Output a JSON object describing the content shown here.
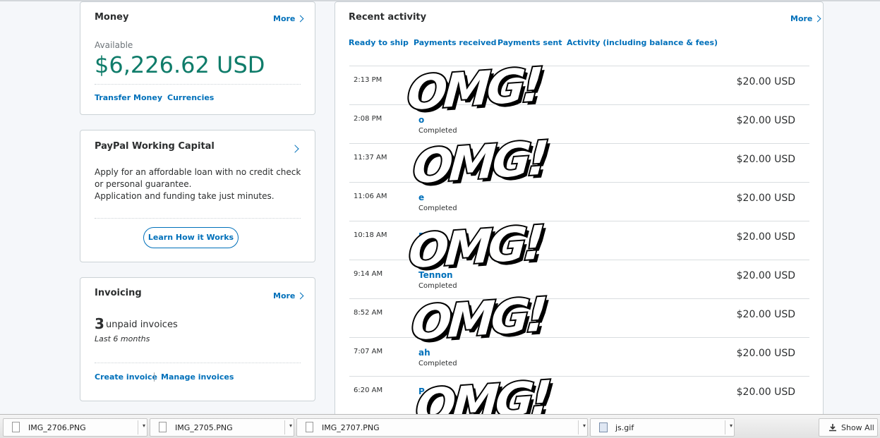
{
  "money": {
    "title": "Money",
    "more": "More",
    "available_label": "Available",
    "amount": "$6,226.62 USD",
    "transfer": "Transfer Money",
    "dot": "·",
    "currencies": "Currencies"
  },
  "working_capital": {
    "title": "PayPal Working Capital",
    "line1": "Apply for an affordable loan with no credit check",
    "line2": "or personal guarantee.",
    "line3": "Application and funding take just minutes.",
    "button": "Learn How it Works"
  },
  "invoicing": {
    "title": "Invoicing",
    "more": "More",
    "count": "3",
    "count_label": "unpaid invoices",
    "period": "Last 6 months",
    "create": "Create invoice",
    "manage": "Manage invoices"
  },
  "activity": {
    "title": "Recent activity",
    "more": "More",
    "tabs": [
      "Ready to ship",
      "Payments received",
      "Payments sent",
      "Activity (including balance & fees)"
    ],
    "rows": [
      {
        "time": "2:13 PM",
        "name": "",
        "status": "",
        "amount": "$20.00 USD"
      },
      {
        "time": "2:08 PM",
        "name": "o",
        "status": "Completed",
        "amount": "$20.00 USD"
      },
      {
        "time": "11:37 AM",
        "name": "P",
        "status": "",
        "amount": "$20.00 USD"
      },
      {
        "time": "11:06 AM",
        "name": "e",
        "status": "Completed",
        "amount": "$20.00 USD"
      },
      {
        "time": "10:18 AM",
        "name": "P",
        "status": "",
        "amount": "$20.00 USD"
      },
      {
        "time": "9:14 AM",
        "name": "Tennon",
        "status": "Completed",
        "amount": "$20.00 USD"
      },
      {
        "time": "8:52 AM",
        "name": "P",
        "status": "",
        "amount": "$20.00 USD"
      },
      {
        "time": "7:07 AM",
        "name": "ah",
        "status": "Completed",
        "amount": "$20.00 USD"
      },
      {
        "time": "6:20 AM",
        "name": "P",
        "status": "",
        "amount": "$20.00 USD"
      }
    ]
  },
  "overlay": {
    "word": "OMG!"
  },
  "downloads": {
    "items": [
      "IMG_2706.PNG",
      "IMG_2705.PNG",
      "IMG_2707.PNG",
      "js.gif"
    ],
    "show_all": "Show All"
  }
}
